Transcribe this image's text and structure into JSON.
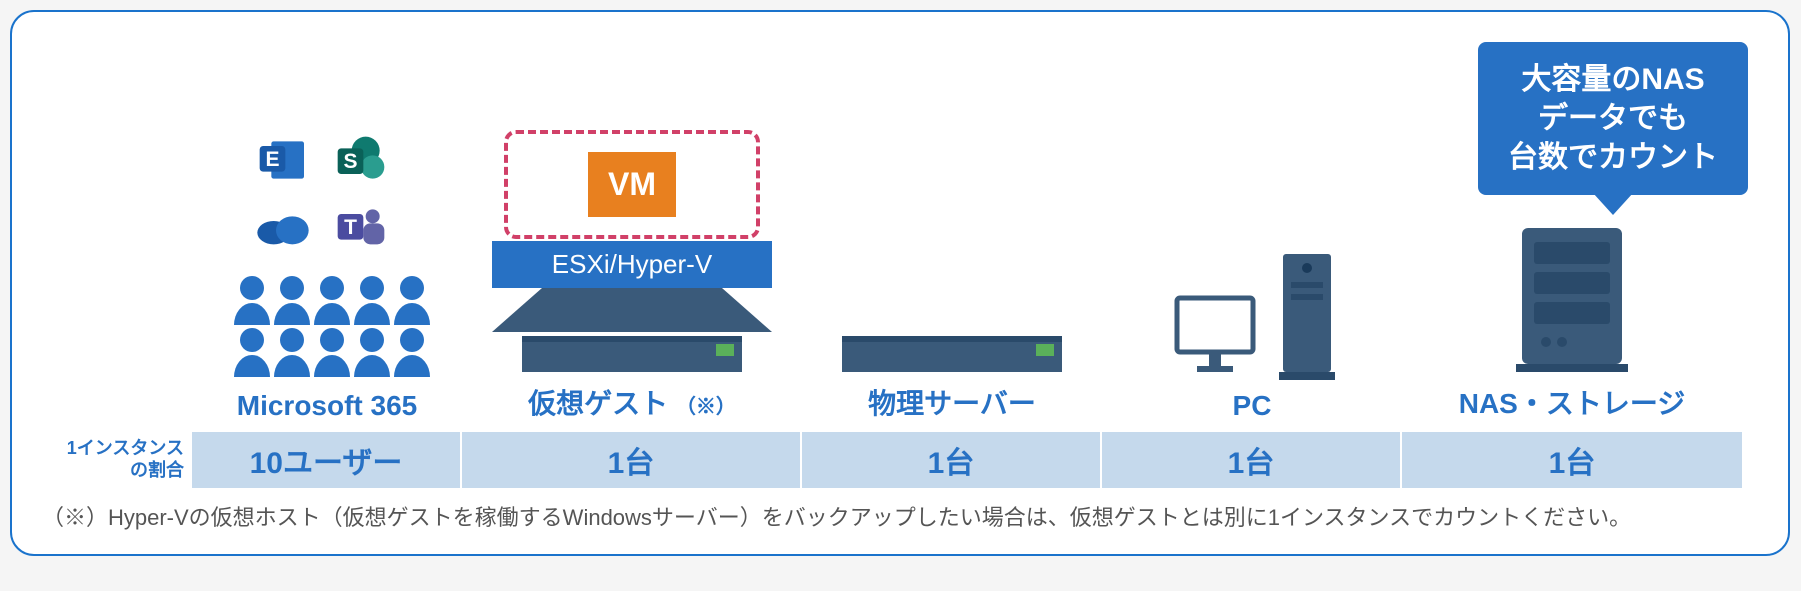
{
  "callout": {
    "line1": "大容量のNAS",
    "line2": "データでも",
    "line3": "台数でカウント"
  },
  "columns": {
    "m365": {
      "title": "Microsoft 365",
      "ratio": "10ユーザー"
    },
    "virtual": {
      "title": "仮想ゲスト",
      "note": "（※）",
      "vm_label": "VM",
      "host_label": "ESXi/Hyper-V",
      "ratio": "1台"
    },
    "physical": {
      "title": "物理サーバー",
      "ratio": "1台"
    },
    "pc": {
      "title": "PC",
      "ratio": "1台"
    },
    "nas": {
      "title": "NAS・ストレージ",
      "ratio": "1台"
    }
  },
  "ratio_label_line1": "1インスタンス",
  "ratio_label_line2": "の割合",
  "footnote": "（※）Hyper-Vの仮想ホスト（仮想ゲストを稼働するWindowsサーバー）をバックアップしたい場合は、仮想ゲストとは別に1インスタンスでカウントください。"
}
